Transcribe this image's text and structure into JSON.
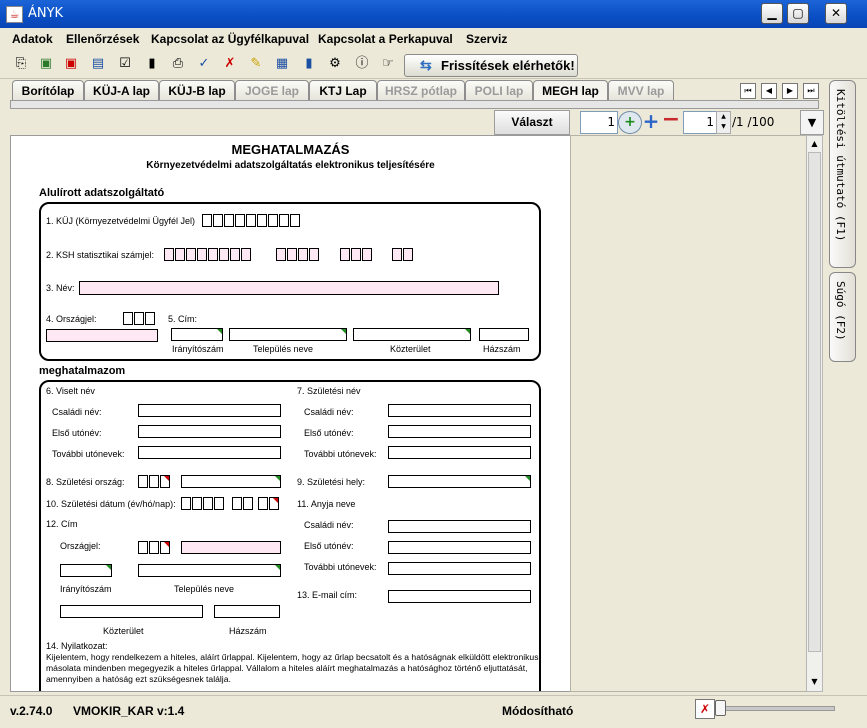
{
  "window": {
    "title": "ÁNYK",
    "app_icon": "java-icon",
    "buttons": [
      "minimize-icon",
      "maximize-icon",
      "close-icon"
    ]
  },
  "menubar": [
    "Adatok",
    "Ellenőrzések",
    "Kapcsolat az Ügyfélkapuval",
    "Kapcsolat a Perkapuval",
    "Szerviz"
  ],
  "toolbar": {
    "icons": [
      "copy-icon",
      "open-icon",
      "delete-file-icon",
      "save-icon",
      "checklist-icon",
      "bookmark-icon",
      "print-icon",
      "check-icon",
      "cancel-icon",
      "edit-icon",
      "calculator-icon",
      "battery-icon",
      "tools-icon",
      "info-icon",
      "pointer-icon"
    ],
    "refresh_label": "Frissítések elérhetők!"
  },
  "tabs": [
    {
      "label": "Borítólap",
      "state": "enabled"
    },
    {
      "label": "KÜJ-A lap",
      "state": "enabled"
    },
    {
      "label": "KÜJ-B lap",
      "state": "enabled"
    },
    {
      "label": "JOGE lap",
      "state": "disabled"
    },
    {
      "label": "KTJ Lap",
      "state": "enabled"
    },
    {
      "label": "HRSZ pótlap",
      "state": "disabled"
    },
    {
      "label": "POLI lap",
      "state": "disabled"
    },
    {
      "label": "MEGH lap",
      "state": "selected"
    },
    {
      "label": "MVV lap",
      "state": "disabled"
    }
  ],
  "controls": {
    "select_label": "Választ",
    "page_number": "1",
    "spinner_value": "1",
    "page_count": "/1 /100"
  },
  "side_tabs": {
    "guide": "Kitöltési útmutató (F1)",
    "help": "Súgó (F2)"
  },
  "form": {
    "title": "MEGHATALMAZÁS",
    "subtitle": "Környezetvédelmi adatszolgáltatás elektronikus teljesítésére",
    "section1_heading": "Alulírott adatszolgáltató",
    "kuj_label": "1. KÜJ (Környezetvédelmi Ügyfél Jel)",
    "ksh_label": "2. KSH statisztikai számjel:",
    "nev_label": "3. Név:",
    "orszagjel_label": "4. Országjel:",
    "cim_label": "5. Cím:",
    "iranyitoszam_label": "Irányítószám",
    "telepules_label": "Település neve",
    "kozterulet_label": "Közterület",
    "hazszam_label": "Házszám",
    "section2_heading": "meghatalmazom",
    "viselt_nev_label": "6. Viselt név",
    "csaladi_nev_label": "Családi név:",
    "elso_utonev_label": "Első utónév:",
    "tovabbi_utonevek_label": "További utónevek:",
    "szuletesi_nev_label": "7. Születési név",
    "szul_orszag_label": "8. Születési ország:",
    "szul_hely_label": "9. Születési hely:",
    "szul_datum_label": "10. Születési dátum (év/hó/nap):",
    "anyja_neve_label": "11. Anyja neve",
    "cim12_label": "12. Cím",
    "orszagjel2_label": "Országjel:",
    "email_label": "13. E-mail cím:",
    "nyilatkozat_label": "14. Nyilatkozat:",
    "nyilatkozat_text": "Kijelentem, hogy rendelkezem a hiteles, aláírt űrlappal. Kijelentem, hogy az űrlap becsatolt és a hatóságnak elküldött elektronikus másolata mindenben megegyezik a hiteles űrlappal. Vállalom a hiteles aláírt meghatalmazás a hatósághoz történő eljuttatását, amennyiben a hatóság ezt szükségesnek találja."
  },
  "statusbar": {
    "version": "v.2.74.0",
    "template": "VMOKIR_KAR v:1.4",
    "mode": "Módosítható"
  }
}
